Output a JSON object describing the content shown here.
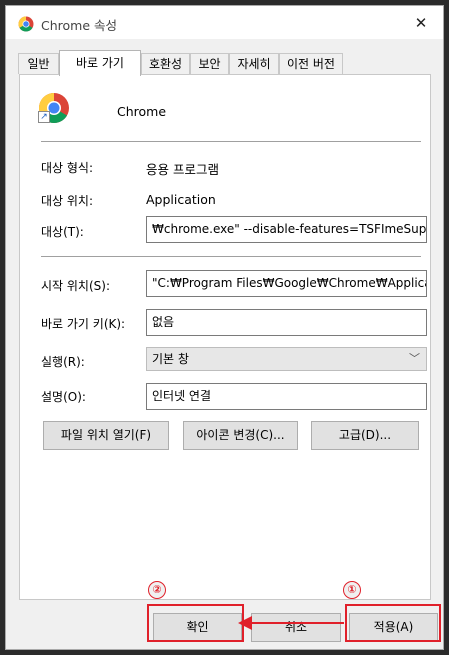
{
  "window": {
    "title": "Chrome 속성",
    "close_glyph": "✕"
  },
  "tabs": [
    {
      "label": "일반"
    },
    {
      "label": "바로 가기"
    },
    {
      "label": "호환성"
    },
    {
      "label": "보안"
    },
    {
      "label": "자세히"
    },
    {
      "label": "이전 버전"
    }
  ],
  "active_tab": "바로 가기",
  "shortcut": {
    "app_name": "Chrome",
    "target_type_label": "대상 형식:",
    "target_type_value": "응용 프로그램",
    "target_location_label": "대상 위치:",
    "target_location_value": "Application",
    "target_label": "대상(T):",
    "target_value": "₩chrome.exe\" --disable-features=TSFImeSupport",
    "start_in_label": "시작 위치(S):",
    "start_in_value": "\"C:₩Program Files₩Google₩Chrome₩Application\"",
    "shortcut_key_label": "바로 가기 키(K):",
    "shortcut_key_value": "없음",
    "run_label": "실행(R):",
    "run_value": "기본 창",
    "comment_label": "설명(O):",
    "comment_value": "인터넷 연결"
  },
  "panel_buttons": {
    "open_location": "파일 위치 열기(F)",
    "change_icon": "아이콘 변경(C)...",
    "advanced": "고급(D)..."
  },
  "dialog_buttons": {
    "ok": "확인",
    "cancel": "취소",
    "apply": "적용(A)"
  },
  "annotations": {
    "step1": "①",
    "step2": "②",
    "color": "#e0202a"
  },
  "icons": {
    "title": "chrome-icon",
    "app": "chrome-icon",
    "shortcut_overlay": "shortcut-arrow-icon",
    "dropdown": "chevron-down-icon"
  }
}
